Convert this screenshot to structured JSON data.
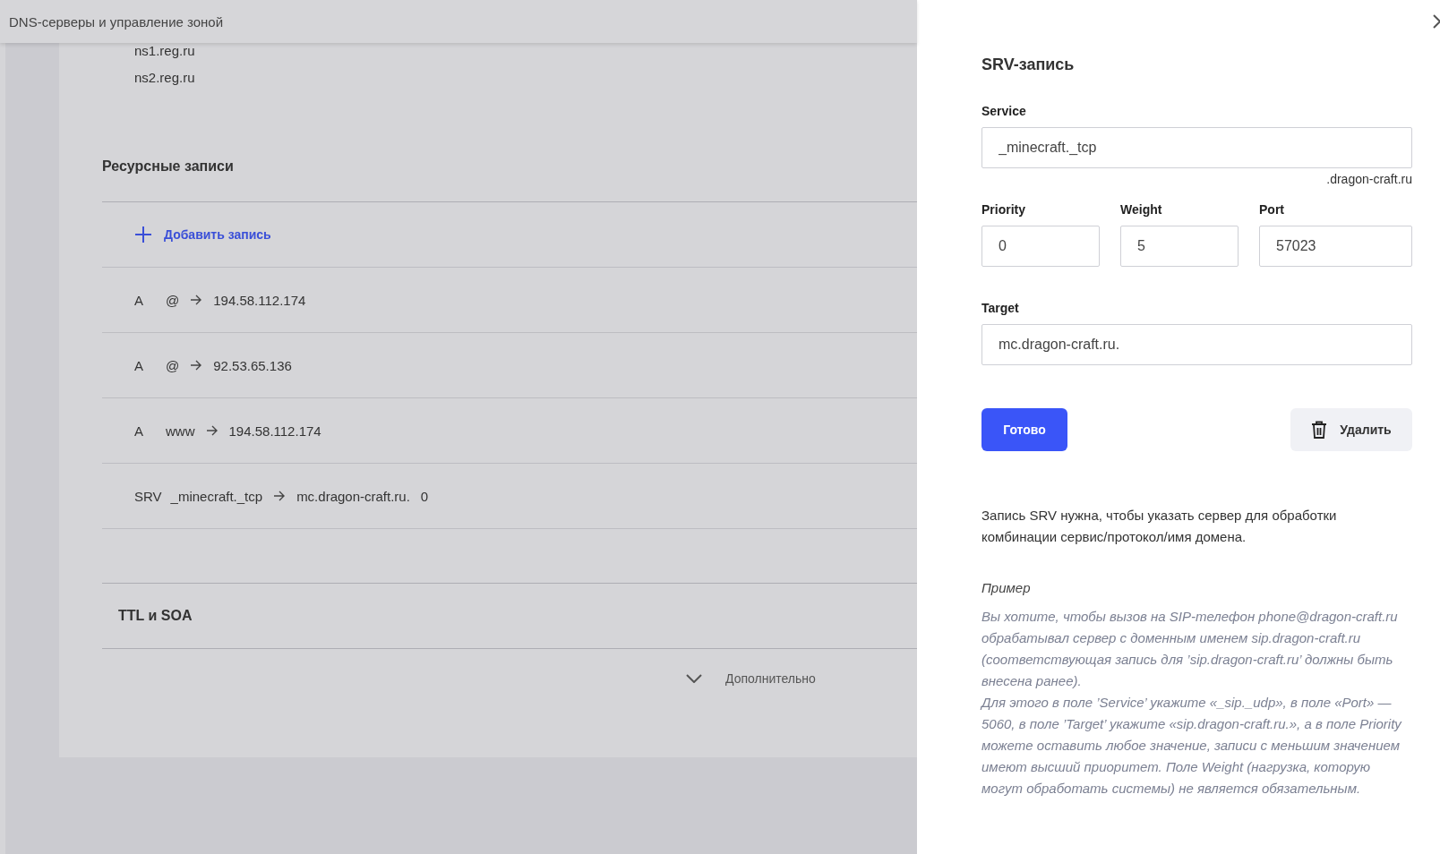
{
  "header": {
    "title": "DNS-серверы и управление зоной"
  },
  "nameservers": [
    "ns1.reg.ru",
    "ns2.reg.ru"
  ],
  "records_section": {
    "title": "Ресурсные записи",
    "add_label": "Добавить запись",
    "records": [
      {
        "type": "A",
        "name": "@",
        "value": "194.58.112.174"
      },
      {
        "type": "A",
        "name": "@",
        "value": "92.53.65.136"
      },
      {
        "type": "A",
        "name": "www",
        "value": "194.58.112.174"
      },
      {
        "type": "SRV",
        "name": "_minecraft._tcp",
        "value": "mc.dragon-craft.ru.",
        "extra": "0"
      }
    ]
  },
  "ttl_section": {
    "title": "TTL и SOA",
    "more_label": "Дополнительно"
  },
  "panel": {
    "title": "SRV-запись",
    "service": {
      "label": "Service",
      "value": "_minecraft._tcp",
      "suffix": ".dragon-craft.ru"
    },
    "numbers": [
      {
        "label": "Priority",
        "value": "0"
      },
      {
        "label": "Weight",
        "value": "5"
      },
      {
        "label": "Port",
        "value": "57023"
      }
    ],
    "target": {
      "label": "Target",
      "value": "mc.dragon-craft.ru."
    },
    "done_button": "Готово",
    "delete_button": "Удалить",
    "description": "Запись SRV нужна, чтобы указать сервер для обработки комбинации сервис/протокол/имя домена.",
    "example_title": "Пример",
    "example_paragraphs": [
      "Вы хотите, чтобы вызов на SIP-телефон phone@dragon-craft.ru обрабатывал сервер с доменным именем sip.dragon-craft.ru (соответствующая запись для ’sip.dragon-craft.ru’ должны быть внесена ранее).",
      "Для этого в поле ’Service’ укажите «_sip._udp», в поле «Port» — 5060, в поле ’Target’ укажите «sip.dragon-craft.ru.», а в поле Priority можете оставить любое значение, записи с меньшим значением имеют высший приоритет. Поле Weight (нагрузка, которую могут обработать системы) не является обязательным."
    ]
  }
}
